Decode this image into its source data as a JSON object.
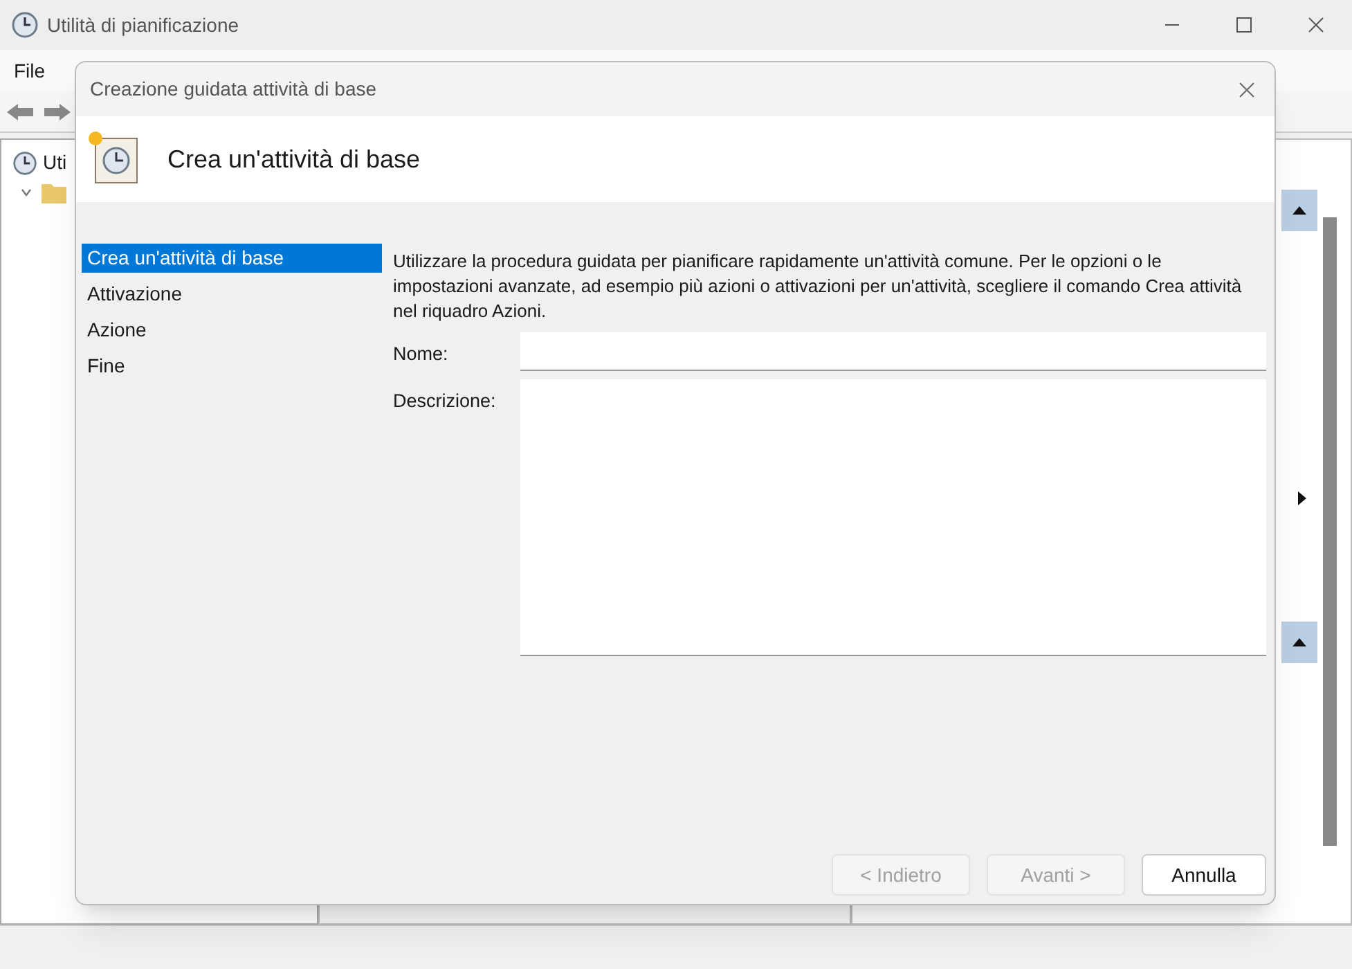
{
  "window": {
    "title": "Utilità di pianificazione"
  },
  "menu": [
    "File"
  ],
  "tree": {
    "root": "Uti",
    "expanded": true
  },
  "dialog": {
    "title": "Creazione guidata attività di base",
    "heading": "Crea un'attività di base",
    "steps": [
      {
        "label": "Crea un'attività di base",
        "selected": true
      },
      {
        "label": "Attivazione",
        "selected": false
      },
      {
        "label": "Azione",
        "selected": false
      },
      {
        "label": "Fine",
        "selected": false
      }
    ],
    "description": "Utilizzare la procedura guidata per pianificare rapidamente un'attività comune. Per le opzioni o le impostazioni avanzate, ad esempio più azioni o attivazioni per un'attività, scegliere il comando Crea attività nel riquadro Azioni.",
    "fields": [
      {
        "label": "Nome:",
        "kind": "line"
      },
      {
        "label": "Descrizione:",
        "kind": "area"
      }
    ],
    "buttons": [
      {
        "label": "< Indietro",
        "disabled": true
      },
      {
        "label": "Avanti >",
        "disabled": true
      },
      {
        "label": "Annulla",
        "disabled": false
      }
    ]
  }
}
